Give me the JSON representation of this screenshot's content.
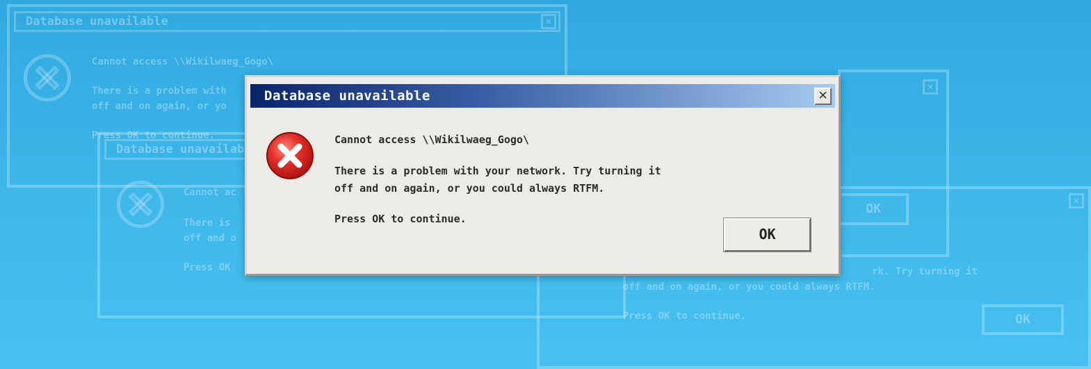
{
  "background_dialogs": [
    {
      "title": "Database unavailable",
      "path_line": "Cannot access \\\\Wikilwaeg_Gogo\\",
      "body_lines": [
        "There is a problem with",
        "off and on again, or yo"
      ],
      "press_line": "Press OK to continue."
    },
    {
      "title": "Database unavailable",
      "path_line": "Cannot ac",
      "body_lines": [
        "There is",
        "off and o"
      ],
      "press_line": "Press OK"
    },
    {
      "body_lines": [
        "rk. Try turning it",
        "off and on again, or you could always RTFM."
      ],
      "press_line": "Press OK to continue.",
      "ok_label": "OK"
    },
    {
      "ok_label": "OK"
    }
  ],
  "dialog": {
    "title": "Database unavailable",
    "close_glyph": "✕",
    "path_line": "Cannot access \\\\Wikilwaeg_Gogo\\",
    "body_lines": [
      "There is a problem with your network. Try turning it",
      "off and on again, or you could always RTFM."
    ],
    "press_line": "Press OK to continue.",
    "ok_label": "OK",
    "icon": "error-x-icon"
  },
  "colors": {
    "desktop_background": "#3eb8ea",
    "titlebar_start": "#0a246a",
    "titlebar_end": "#a6caf0",
    "dialog_face": "#ecebe6",
    "error_icon": "#d41f1f"
  }
}
